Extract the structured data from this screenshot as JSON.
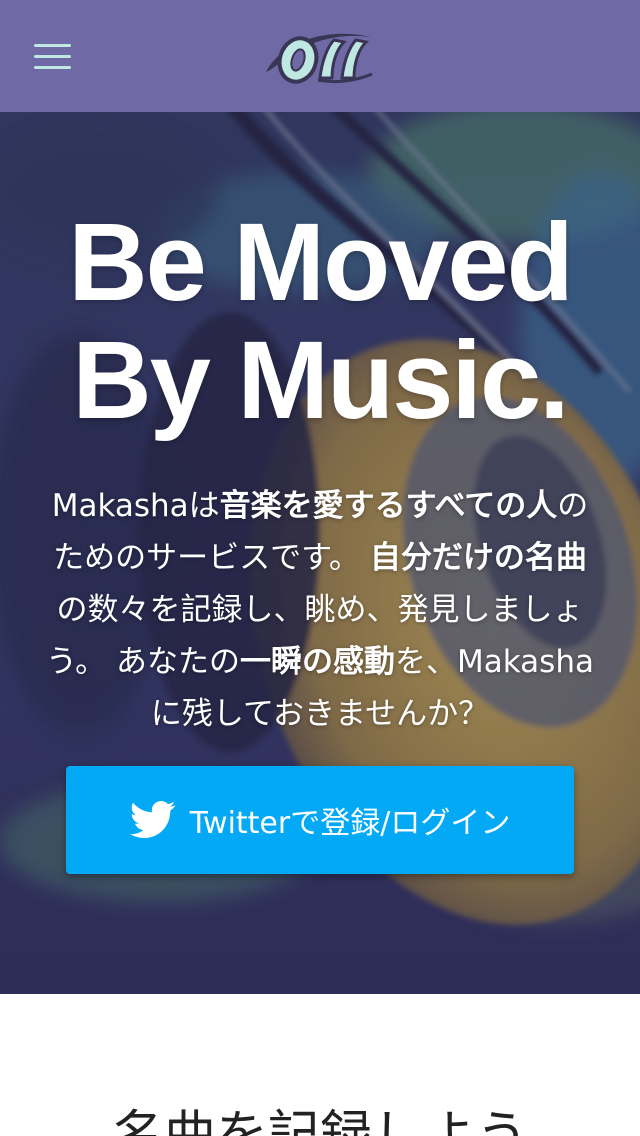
{
  "header": {
    "menu_icon": "hamburger-menu-icon",
    "logo_text": "OM"
  },
  "hero": {
    "title_line1": "Be Moved",
    "title_line2": "By Music.",
    "desc": {
      "p1": "Makasha",
      "p2": "は",
      "b1": "音楽を愛するすべての人",
      "p3": "のためのサービスです。 ",
      "b2": "自分だけの名曲",
      "p4": "の数々を記録し、眺め、発見しましょう。 あなたの",
      "b3": "一瞬の感動",
      "p5": "を、Makashaに残しておきませんか？"
    },
    "twitter_button_label": "Twitterで登録/ログイン",
    "twitter_icon": "twitter-bird-icon"
  },
  "next_section": {
    "title": "名曲を記録しよう"
  },
  "colors": {
    "header_bg": "#6f6aa6",
    "menu_icon": "#bfe8e2",
    "logo_fill": "#bfe8e2",
    "twitter_button": "#03a9f4",
    "hero_overlay": "#343062"
  }
}
